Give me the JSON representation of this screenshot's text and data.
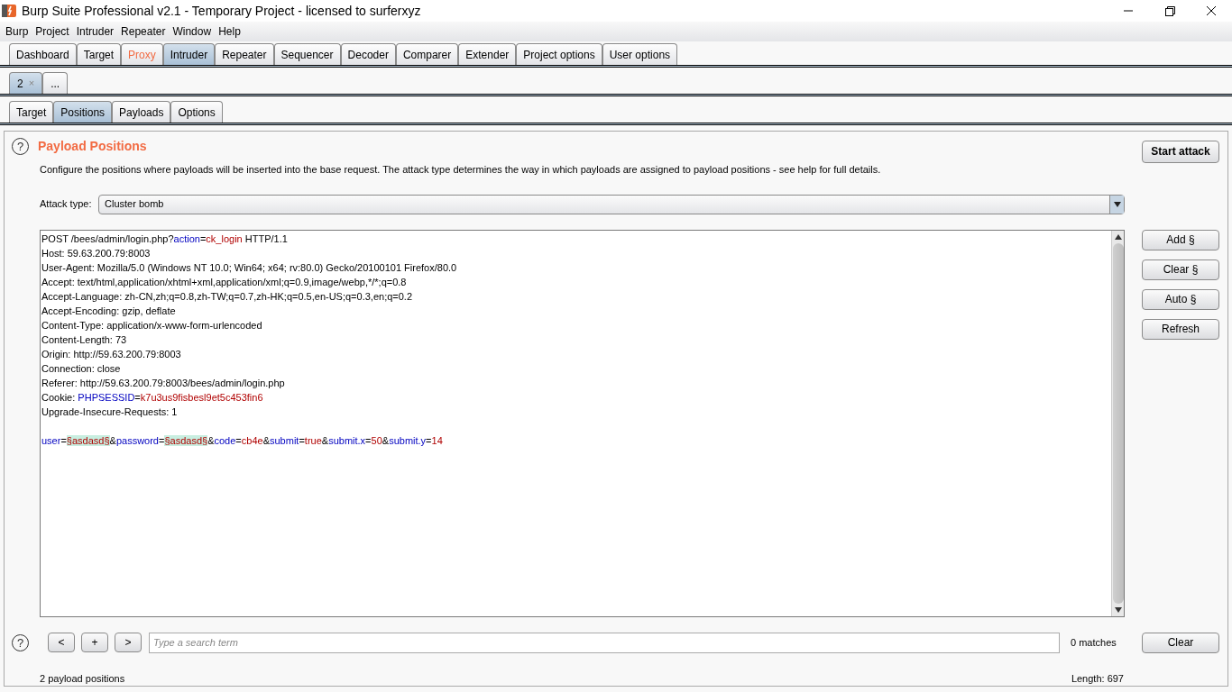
{
  "window": {
    "title": "Burp Suite Professional v2.1 - Temporary Project - licensed to surferxyz"
  },
  "menu": [
    "Burp",
    "Project",
    "Intruder",
    "Repeater",
    "Window",
    "Help"
  ],
  "main_tabs": [
    {
      "label": "Dashboard",
      "selected": false,
      "alert": false
    },
    {
      "label": "Target",
      "selected": false,
      "alert": false
    },
    {
      "label": "Proxy",
      "selected": false,
      "alert": true
    },
    {
      "label": "Intruder",
      "selected": true,
      "alert": false
    },
    {
      "label": "Repeater",
      "selected": false,
      "alert": false
    },
    {
      "label": "Sequencer",
      "selected": false,
      "alert": false
    },
    {
      "label": "Decoder",
      "selected": false,
      "alert": false
    },
    {
      "label": "Comparer",
      "selected": false,
      "alert": false
    },
    {
      "label": "Extender",
      "selected": false,
      "alert": false
    },
    {
      "label": "Project options",
      "selected": false,
      "alert": false
    },
    {
      "label": "User options",
      "selected": false,
      "alert": false
    }
  ],
  "session_tabs": [
    {
      "label": "2",
      "close": "×",
      "selected": true
    },
    {
      "label": "...",
      "selected": false
    }
  ],
  "sub_tabs": [
    {
      "label": "Target",
      "selected": false
    },
    {
      "label": "Positions",
      "selected": true
    },
    {
      "label": "Payloads",
      "selected": false
    },
    {
      "label": "Options",
      "selected": false
    }
  ],
  "panel": {
    "help": "?",
    "title": "Payload Positions",
    "description": "Configure the positions where payloads will be inserted into the base request. The attack type determines the way in which payloads are assigned to payload positions - see help for full details.",
    "start_button": "Start attack",
    "attack_type_label": "Attack type:",
    "attack_type": "Cluster bomb"
  },
  "request": [
    [
      {
        "kind": "plain",
        "text": "POST /bees/admin/login.php?"
      },
      {
        "kind": "name",
        "text": "action"
      },
      {
        "kind": "plain",
        "text": "="
      },
      {
        "kind": "value",
        "text": "ck_login"
      },
      {
        "kind": "plain",
        "text": " HTTP/1.1"
      }
    ],
    [
      {
        "kind": "plain",
        "text": "Host: 59.63.200.79:8003"
      }
    ],
    [
      {
        "kind": "plain",
        "text": "User-Agent: Mozilla/5.0 (Windows NT 10.0; Win64; x64; rv:80.0) Gecko/20100101 Firefox/80.0"
      }
    ],
    [
      {
        "kind": "plain",
        "text": "Accept: text/html,application/xhtml+xml,application/xml;q=0.9,image/webp,*/*;q=0.8"
      }
    ],
    [
      {
        "kind": "plain",
        "text": "Accept-Language: zh-CN,zh;q=0.8,zh-TW;q=0.7,zh-HK;q=0.5,en-US;q=0.3,en;q=0.2"
      }
    ],
    [
      {
        "kind": "plain",
        "text": "Accept-Encoding: gzip, deflate"
      }
    ],
    [
      {
        "kind": "plain",
        "text": "Content-Type: application/x-www-form-urlencoded"
      }
    ],
    [
      {
        "kind": "plain",
        "text": "Content-Length: 73"
      }
    ],
    [
      {
        "kind": "plain",
        "text": "Origin: http://59.63.200.79:8003"
      }
    ],
    [
      {
        "kind": "plain",
        "text": "Connection: close"
      }
    ],
    [
      {
        "kind": "plain",
        "text": "Referer: http://59.63.200.79:8003/bees/admin/login.php"
      }
    ],
    [
      {
        "kind": "plain",
        "text": "Cookie: "
      },
      {
        "kind": "name",
        "text": "PHPSESSID"
      },
      {
        "kind": "plain",
        "text": "="
      },
      {
        "kind": "value",
        "text": "k7u3us9fisbesl9et5c453fin6"
      }
    ],
    [
      {
        "kind": "plain",
        "text": "Upgrade-Insecure-Requests: 1"
      }
    ]
  ],
  "request_body": [
    [
      {
        "kind": "name",
        "text": "user"
      },
      {
        "kind": "plain",
        "text": "="
      },
      {
        "kind": "marker",
        "text": "§asdasd§"
      },
      {
        "kind": "plain",
        "text": "&"
      },
      {
        "kind": "name",
        "text": "password"
      },
      {
        "kind": "plain",
        "text": "="
      },
      {
        "kind": "marker",
        "text": "§asdasd§"
      },
      {
        "kind": "plain",
        "text": "&"
      },
      {
        "kind": "name",
        "text": "code"
      },
      {
        "kind": "plain",
        "text": "="
      },
      {
        "kind": "value",
        "text": "cb4e"
      },
      {
        "kind": "plain",
        "text": "&"
      },
      {
        "kind": "name",
        "text": "submit"
      },
      {
        "kind": "plain",
        "text": "="
      },
      {
        "kind": "value",
        "text": "true"
      },
      {
        "kind": "plain",
        "text": "&"
      },
      {
        "kind": "name",
        "text": "submit.x"
      },
      {
        "kind": "plain",
        "text": "="
      },
      {
        "kind": "value",
        "text": "50"
      },
      {
        "kind": "plain",
        "text": "&"
      },
      {
        "kind": "name",
        "text": "submit.y"
      },
      {
        "kind": "plain",
        "text": "="
      },
      {
        "kind": "value",
        "text": "14"
      }
    ]
  ],
  "side_buttons": [
    "Add §",
    "Clear §",
    "Auto §",
    "Refresh"
  ],
  "search": {
    "help": "?",
    "prev": "<",
    "add": "+",
    "next": ">",
    "placeholder": "Type a search term",
    "matches": "0 matches",
    "clear": "Clear"
  },
  "status": {
    "positions": "2 payload positions",
    "length": "Length: 697"
  }
}
